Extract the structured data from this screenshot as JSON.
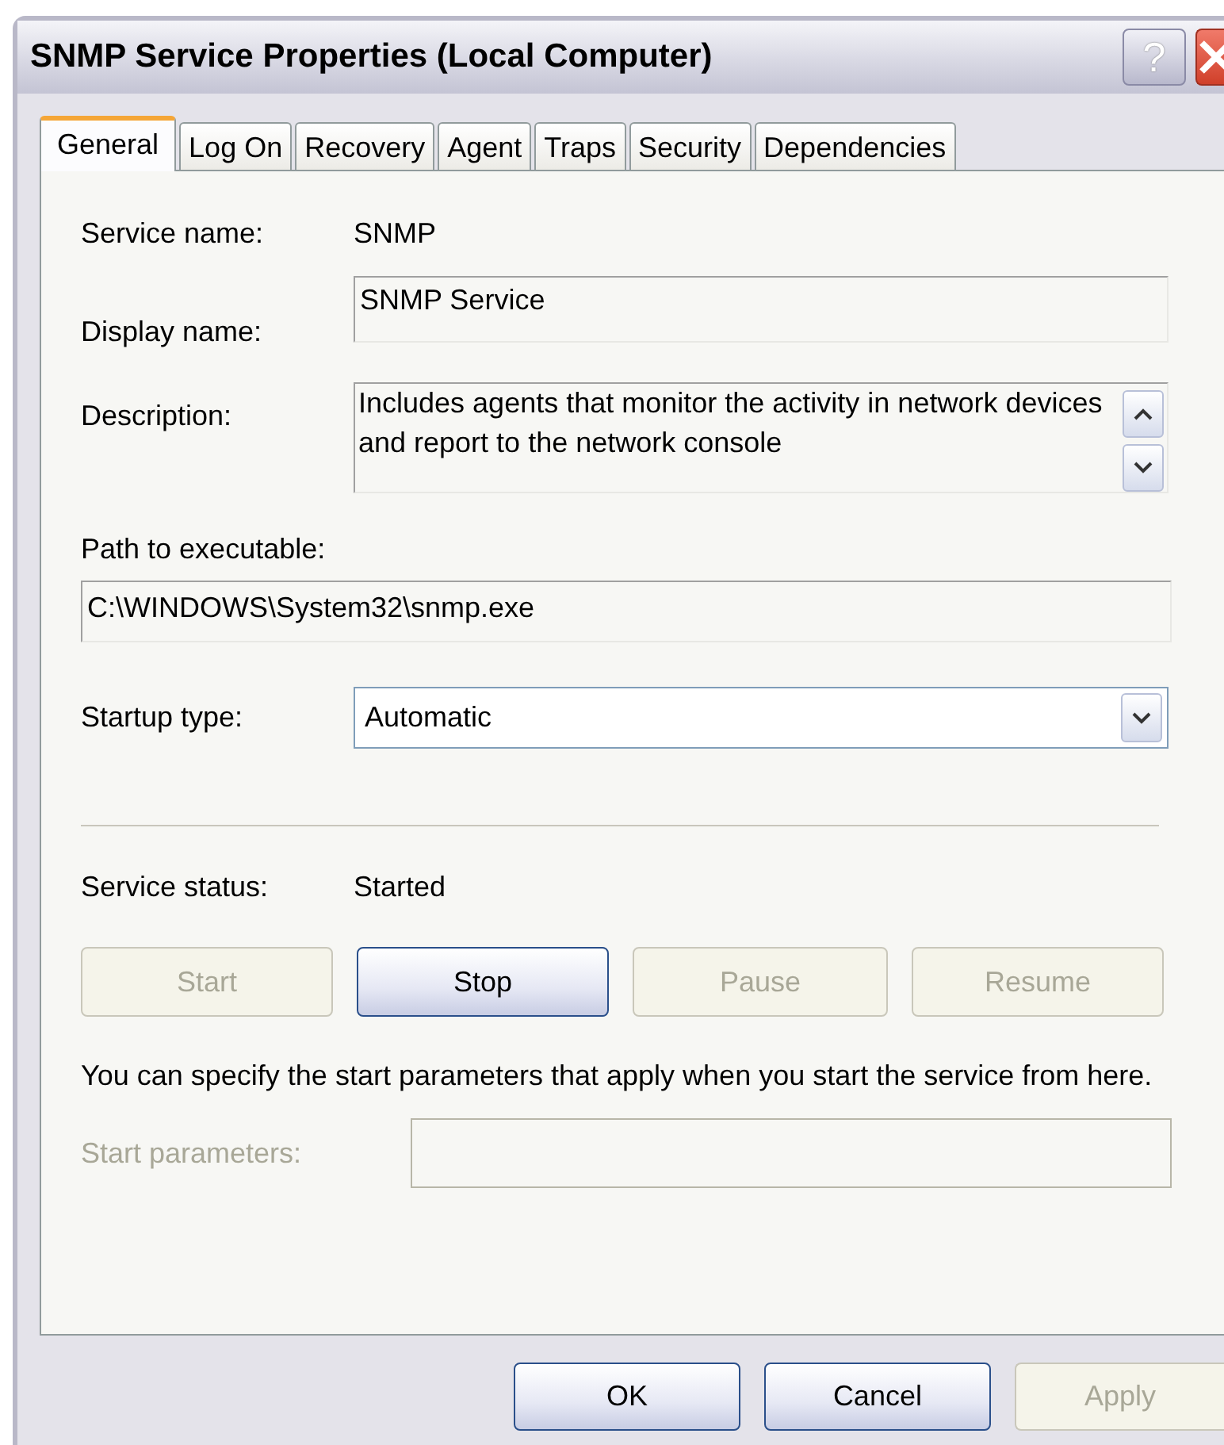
{
  "window": {
    "title": "SNMP Service Properties (Local Computer)",
    "help_button": "?"
  },
  "tabs": [
    {
      "label": "General",
      "selected": true
    },
    {
      "label": "Log On",
      "selected": false
    },
    {
      "label": "Recovery",
      "selected": false
    },
    {
      "label": "Agent",
      "selected": false
    },
    {
      "label": "Traps",
      "selected": false
    },
    {
      "label": "Security",
      "selected": false
    },
    {
      "label": "Dependencies",
      "selected": false
    }
  ],
  "service_name": {
    "label": "Service name:",
    "value": "SNMP"
  },
  "display_name": {
    "label": "Display name:",
    "value": "SNMP Service"
  },
  "description": {
    "label": "Description:",
    "value": "Includes agents that monitor the activity in network devices and report to the network console"
  },
  "path": {
    "label": "Path to executable:",
    "value": "C:\\WINDOWS\\System32\\snmp.exe"
  },
  "startup_type": {
    "label": "Startup type:",
    "value": "Automatic"
  },
  "service_status": {
    "label": "Service status:",
    "value": "Started"
  },
  "control_buttons": [
    {
      "label": "Start",
      "disabled": true
    },
    {
      "label": "Stop",
      "disabled": false
    },
    {
      "label": "Pause",
      "disabled": true
    },
    {
      "label": "Resume",
      "disabled": true
    }
  ],
  "hint": "You can specify the start parameters that apply when you start the service from here.",
  "start_parameters": {
    "label": "Start parameters:",
    "disabled": true
  },
  "dialog_buttons": [
    {
      "label": "OK",
      "disabled": false
    },
    {
      "label": "Cancel",
      "disabled": false
    },
    {
      "label": "Apply",
      "disabled": true
    }
  ]
}
